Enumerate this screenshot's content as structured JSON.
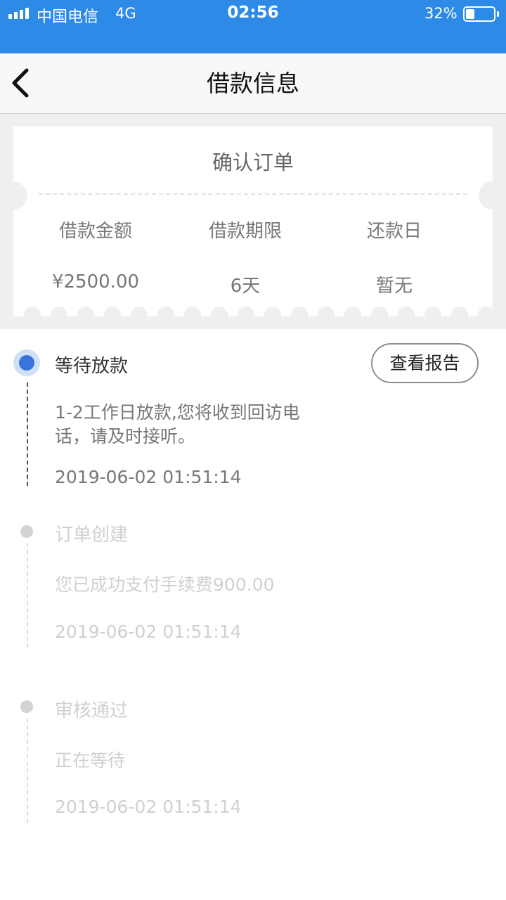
{
  "status_bar": {
    "carrier": "中国电信",
    "network": "4G",
    "time": "02:56",
    "battery_percent": "32%",
    "battery_level": 0.32,
    "background_color": "#2d8ae6"
  },
  "nav": {
    "title": "借款信息",
    "back_icon": "chevron-left-icon"
  },
  "ticket": {
    "title": "确认订单",
    "columns": [
      {
        "label": "借款金额",
        "value": "¥2500.00"
      },
      {
        "label": "借款期限",
        "value": "6天"
      },
      {
        "label": "还款日",
        "value": "暂无"
      }
    ]
  },
  "timeline": {
    "report_button_label": "查看报告",
    "steps": [
      {
        "title": "等待放款",
        "description": "1-2工作日放款,您将收到回访电话，请及时接听。",
        "time": "2019-06-02 01:51:14",
        "active": true
      },
      {
        "title": "订单创建",
        "description": "您已成功支付手续费900.00",
        "time": "2019-06-02 01:51:14",
        "active": false
      },
      {
        "title": "审核通过",
        "description": "正在等待",
        "time": "2019-06-02 01:51:14",
        "active": false
      }
    ]
  },
  "colors": {
    "accent_blue": "#3a72de",
    "inactive_gray": "#d0d0d0"
  }
}
